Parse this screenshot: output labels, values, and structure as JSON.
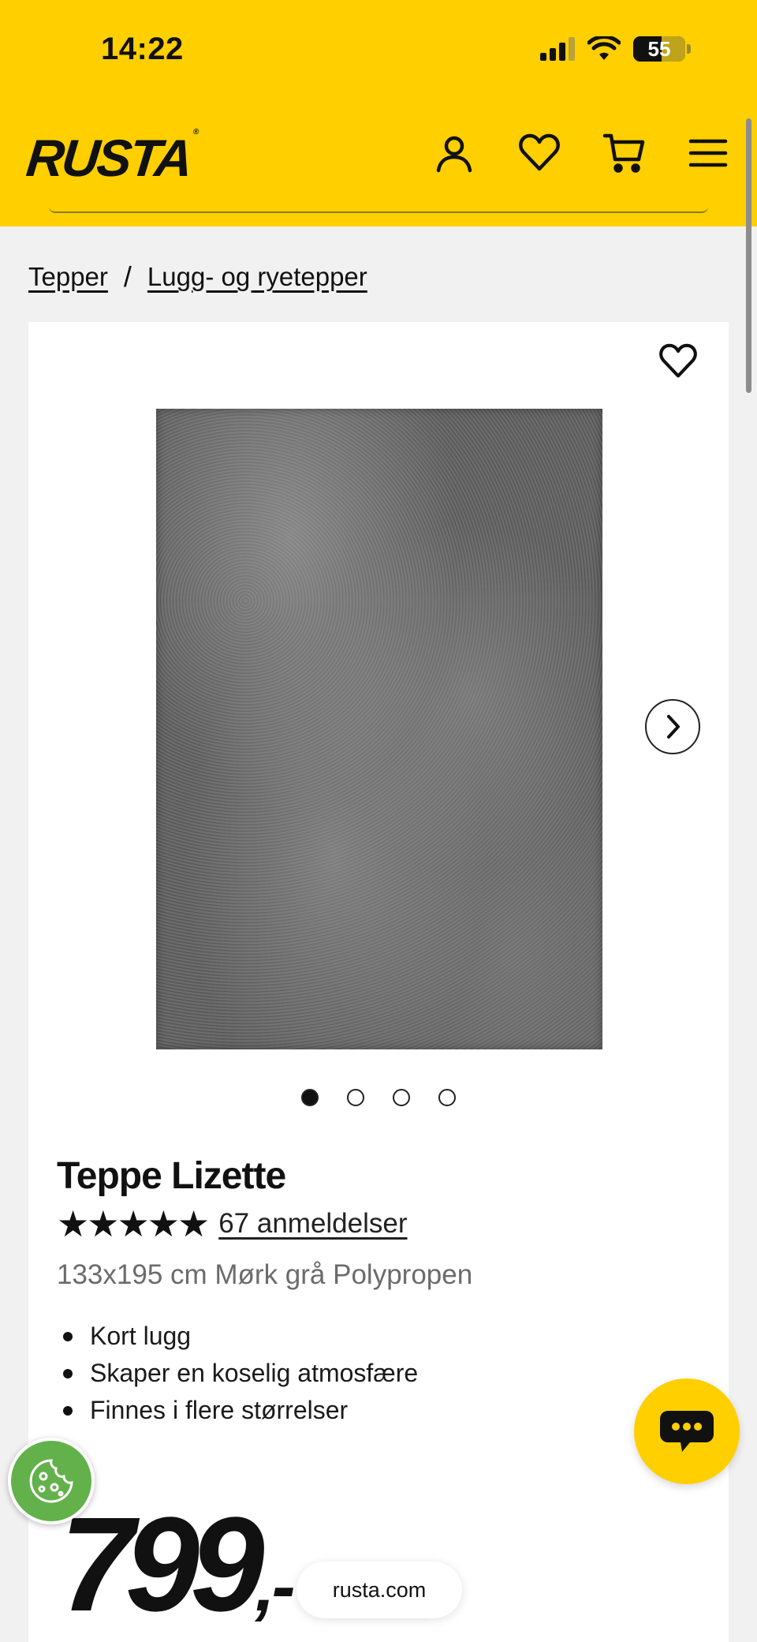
{
  "status_bar": {
    "time": "14:22",
    "battery": "55"
  },
  "header": {
    "logo": "RUSTA",
    "logo_mark": "®"
  },
  "breadcrumb": {
    "items": [
      "Tepper",
      "Lugg- og ryetepper"
    ],
    "separator": "/"
  },
  "product": {
    "title": "Teppe Lizette",
    "rating_stars": "★★★★★",
    "reviews_label": "67 anmeldelser",
    "subtitle": "133x195 cm Mørk grå Polypropen",
    "features": [
      "Kort lugg",
      "Skaper en koselig atmosfære",
      "Finnes i flere størrelser"
    ],
    "price": "799",
    "price_suffix": ",-"
  },
  "gallery": {
    "image_count": 4,
    "active_index": 0
  },
  "browser": {
    "url": "rusta.com"
  },
  "colors": {
    "brand_yellow": "#ffcf00",
    "cookie_green": "#62b14a"
  },
  "icons": [
    "account-icon",
    "heart-icon",
    "cart-icon",
    "menu-icon",
    "chevron-right-icon",
    "chat-icon",
    "cookie-icon"
  ]
}
